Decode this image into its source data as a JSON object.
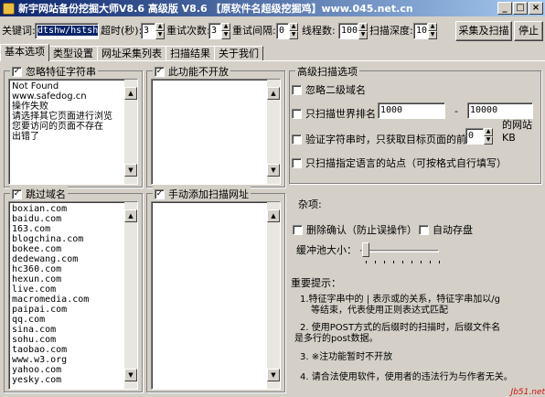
{
  "window": {
    "title": "新宇网站备份挖掘大师V8.6  高级版 V8.6  【原软件名超级挖掘鸡】www.045.net.cn",
    "min": "_",
    "max": "□",
    "close": "×"
  },
  "toolbar": {
    "keyword_label": "关键词:",
    "keyword_value": "dtshw/hstsh",
    "timeout_label": "超时(秒):",
    "timeout_value": "3",
    "retry_label": "重试次数:",
    "retry_value": "3",
    "interval_label": "重试间隔:",
    "interval_value": "0",
    "threads_label": "线程数:",
    "threads_value": "100",
    "depth_label": "扫描深度:",
    "depth_value": "10",
    "collect_button": "采集及扫描",
    "stop_button": "停止"
  },
  "tabs": [
    "基本选项",
    "类型设置",
    "网址采集列表",
    "扫描结果",
    "关于我们"
  ],
  "left": {
    "ignore_feature": {
      "label": "忽略特征字符串",
      "checked": true,
      "lines": "Not Found\nwww.safedog.cn\n操作失败\n请选择其它页面进行浏览\n您要访问的页面不存在\n出错了"
    },
    "not_open": {
      "label": "此功能不开放",
      "checked": true
    },
    "skip_domain": {
      "label": "跳过域名",
      "checked": true,
      "lines": "boxian.com\nbaidu.com\n163.com\nblogchina.com\nbokee.com\ndedewang.com\nhc360.com\nhexun.com\nlive.com\nmacromedia.com\npaipai.com\nqq.com\nsina.com\nsohu.com\ntaobao.com\nwww.w3.org\nyahoo.com\nyesky.com"
    },
    "manual_add": {
      "label": "手动添加扫描网址",
      "checked": true
    }
  },
  "advanced": {
    "group_title": "高级扫描选项",
    "ignore_subdomain": "忽略二级域名",
    "rank_only": "只扫描世界排名",
    "rank_from": "1000",
    "rank_dash": "-",
    "rank_to": "10000",
    "rank_suffix": "的网站",
    "verify_feature": "验证字符串时，只获取目标页面的前",
    "verify_size": "0",
    "verify_unit": "KB",
    "lang_only": "只扫描指定语言的站点（可按格式自行填写）"
  },
  "misc": {
    "title": "杂项:",
    "confirm_delete": "删除确认（防止误操作）",
    "auto_save": "自动存盘",
    "buffer_label": "缓冲池大小："
  },
  "notes": {
    "title": "重要提示：",
    "n1a": "1.特征字串中的 | 表示或的关系，特征字串加以/g",
    "n1b": "等结束，代表使用正则表达式匹配",
    "n2a": "2. 使用POST方式的后缀时的扫描时，后缀文件名",
    "n2b": "是多行的post数据。",
    "n3": "3.   ※注功能暂时不开放",
    "n4": "4. 请合法使用软件，使用者的违法行为与作者无关。"
  },
  "watermark": "Jb51.net"
}
